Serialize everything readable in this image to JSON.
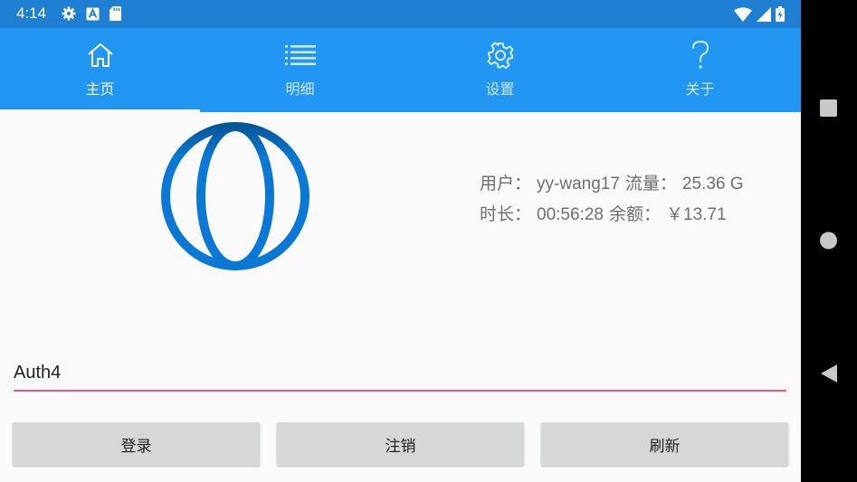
{
  "status_bar": {
    "time": "4:14",
    "left_icons": [
      "settings-icon",
      "a-badge-icon",
      "sd-card-icon"
    ],
    "right_icons": [
      "wifi-icon",
      "signal-icon",
      "battery-charging-icon"
    ]
  },
  "tabs": [
    {
      "label": "主页",
      "icon": "home-icon",
      "active": true
    },
    {
      "label": "明细",
      "icon": "list-icon",
      "active": false
    },
    {
      "label": "设置",
      "icon": "gear-icon",
      "active": false
    },
    {
      "label": "关于",
      "icon": "question-icon",
      "active": false
    }
  ],
  "account": {
    "user_label": "用户：",
    "user_value": "yy-wang17",
    "traffic_label": "流量：",
    "traffic_value": "25.36 G",
    "duration_label": "时长：",
    "duration_value": "00:56:28",
    "balance_label": "余额：",
    "balance_value": "￥13.71"
  },
  "auth_input": {
    "value": "Auth4"
  },
  "buttons": {
    "login": "登录",
    "logout": "注销",
    "refresh": "刷新"
  },
  "colors": {
    "status_bar": "#1f7fd2",
    "tab_bar": "#2196f3",
    "accent_underline": "#e8588a",
    "globe": "#0a78d4",
    "button_bg": "#d6d7d7"
  }
}
